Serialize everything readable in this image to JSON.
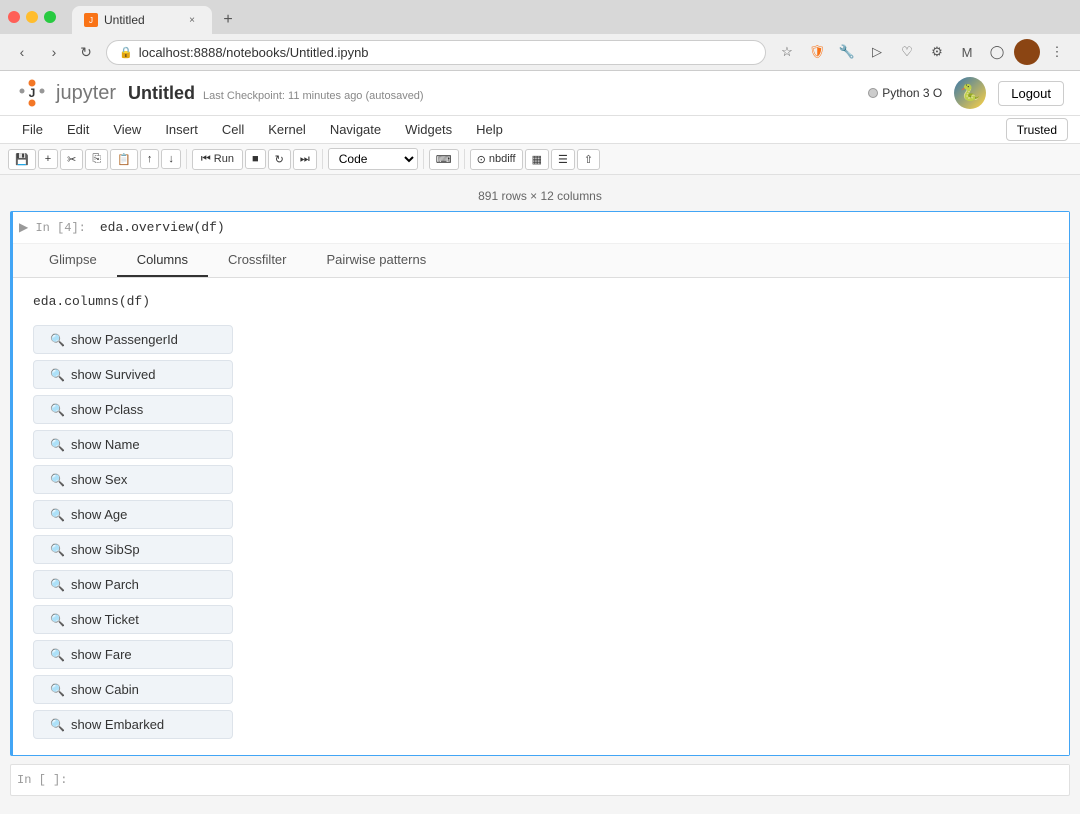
{
  "browser": {
    "tab_title": "Untitled",
    "tab_favicon": "🔶",
    "url": "localhost:8888/notebooks/Untitled.ipynb",
    "new_tab_label": "+"
  },
  "jupyter": {
    "logo_text": "jupyter",
    "notebook_title": "Untitled",
    "checkpoint_text": "Last Checkpoint: 11 minutes ago",
    "autosaved_text": "(autosaved)",
    "logout_label": "Logout",
    "kernel_label": "Python 3 O",
    "trusted_label": "Trusted"
  },
  "menu": {
    "items": [
      "File",
      "Edit",
      "View",
      "Insert",
      "Cell",
      "Kernel",
      "Navigate",
      "Widgets",
      "Help"
    ]
  },
  "toolbar": {
    "save_label": "💾",
    "add_label": "+",
    "cut_label": "✂",
    "copy_label": "📋",
    "paste_label": "📋",
    "up_label": "↑",
    "down_label": "↓",
    "run_label": "Run",
    "stop_label": "■",
    "restart_label": "↺",
    "fast_forward_label": "⏭",
    "code_type": "Code",
    "nbdiff_label": "nbdiff",
    "keyboard_label": "⌨",
    "list_label": "☰",
    "share_label": "⇧"
  },
  "notebook": {
    "info_row": "891 rows × 12 columns",
    "cell_in4_label": "In [4]:",
    "cell_in4_code": "eda.overview(df)",
    "cell_empty_label": "In [ ]:",
    "output_tabs": [
      "Glimpse",
      "Columns",
      "Crossfilter",
      "Pairwise patterns"
    ],
    "active_tab": "Columns",
    "output_code": "eda.columns(df)",
    "columns": [
      {
        "label": "show PassengerId"
      },
      {
        "label": "show Survived"
      },
      {
        "label": "show Pclass"
      },
      {
        "label": "show Name"
      },
      {
        "label": "show Sex"
      },
      {
        "label": "show Age"
      },
      {
        "label": "show SibSp"
      },
      {
        "label": "show Parch"
      },
      {
        "label": "show Ticket"
      },
      {
        "label": "show Fare"
      },
      {
        "label": "show Cabin"
      },
      {
        "label": "show Embarked"
      }
    ]
  }
}
